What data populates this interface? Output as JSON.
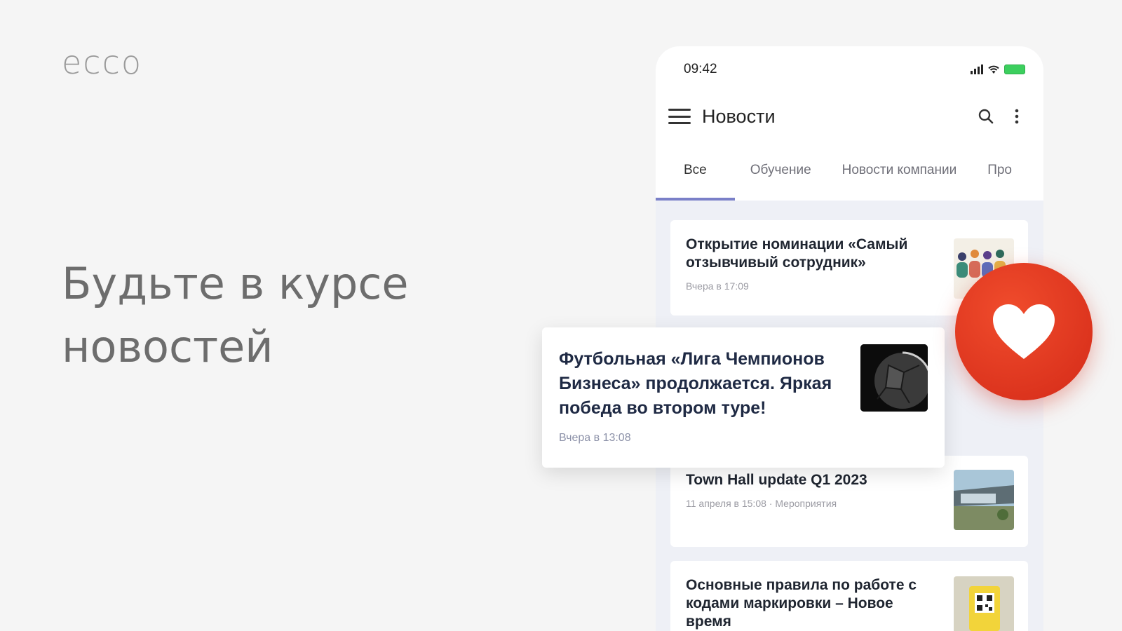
{
  "brand": {
    "logo_text": "ecco"
  },
  "hero": {
    "headline": "Будьте в курсе новостей"
  },
  "phone": {
    "status": {
      "time": "09:42"
    },
    "appbar": {
      "title": "Новости"
    },
    "tabs": [
      {
        "label": "Все",
        "active": true
      },
      {
        "label": "Обучение"
      },
      {
        "label": "Новости компании"
      },
      {
        "label": "Про"
      }
    ],
    "news": [
      {
        "title": "Открытие номинации «Самый отзывчивый сотрудник»",
        "meta": "Вчера в 17:09"
      },
      {
        "title": "Town Hall update Q1 2023",
        "meta": "11 апреля в 15:08 · Мероприятия"
      },
      {
        "title": "Основные правила по работе с кодами маркировки – Новое время",
        "meta": ""
      }
    ]
  },
  "featured": {
    "title": "Футбольная «Лига Чемпионов Бизнеса» продолжается. Яркая победа во втором туре!",
    "meta": "Вчера в 13:08"
  },
  "colors": {
    "accent": "#7a80c8",
    "heart": "#e0391f"
  }
}
